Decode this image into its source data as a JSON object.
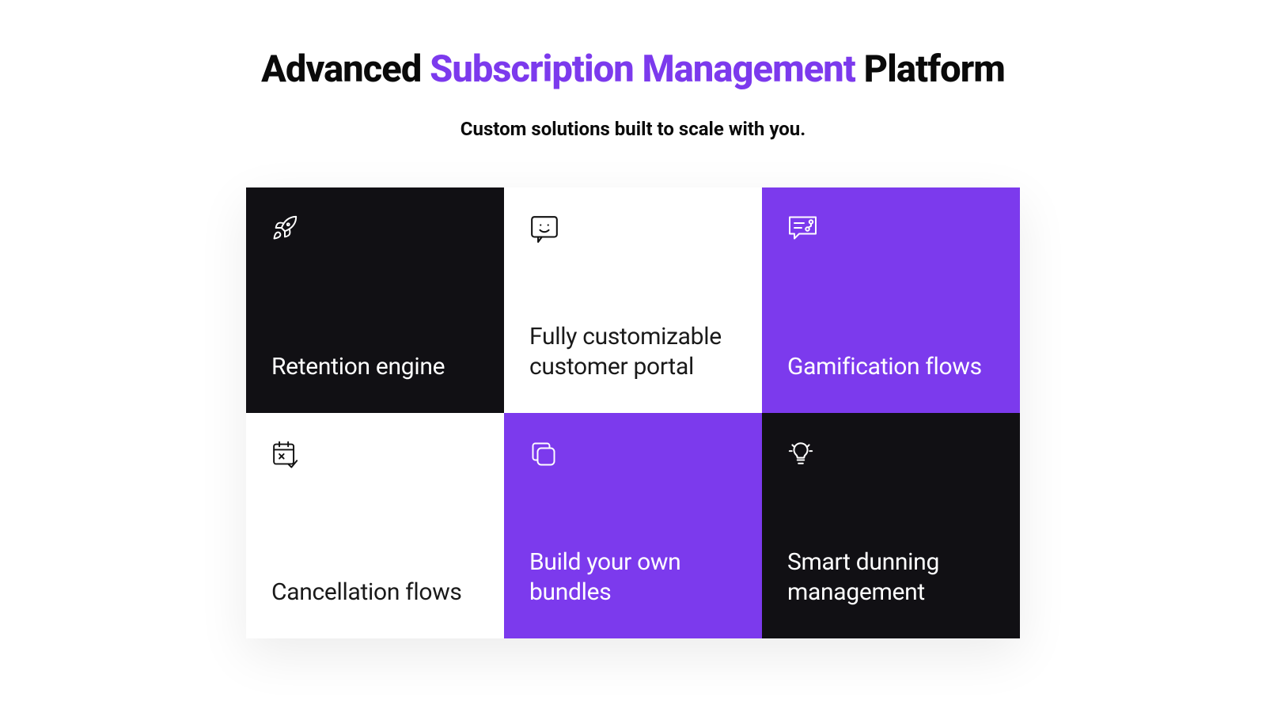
{
  "heading": {
    "before": "Advanced ",
    "accent": "Subscription Management",
    "after": " Platform"
  },
  "subheading": "Custom solutions built to scale with you.",
  "tiles": [
    {
      "title": "Retention engine"
    },
    {
      "title": "Fully customizable customer portal"
    },
    {
      "title": "Gamification flows"
    },
    {
      "title": "Cancellation flows"
    },
    {
      "title": "Build your own bundles"
    },
    {
      "title": "Smart dunning management"
    }
  ]
}
